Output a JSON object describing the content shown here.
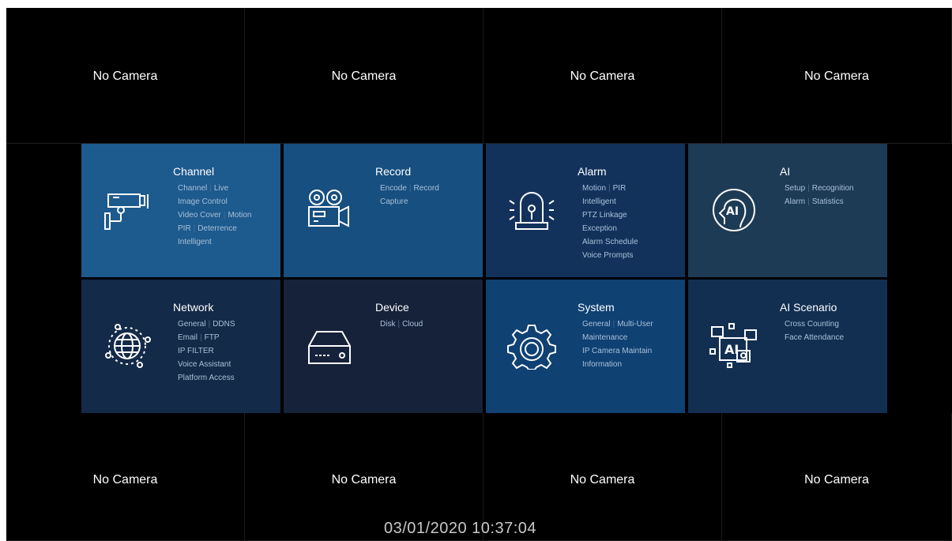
{
  "camera_label": "No Camera",
  "timestamp": "03/01/2020 10:37:04",
  "menu": {
    "channel": {
      "title": "Channel",
      "links": [
        "Channel",
        "Live",
        "Image Control",
        "Video Cover",
        "Motion",
        "PIR",
        "Deterrence",
        "Intelligent"
      ],
      "icon": "security-camera-icon",
      "color": "#1d5a8e"
    },
    "record": {
      "title": "Record",
      "links": [
        "Encode",
        "Record",
        "Capture"
      ],
      "icon": "film-camera-icon",
      "color": "#174f80"
    },
    "alarm": {
      "title": "Alarm",
      "links": [
        "Motion",
        "PIR",
        "Intelligent",
        "PTZ Linkage",
        "Exception",
        "Alarm Schedule",
        "Voice Prompts"
      ],
      "icon": "alarm-siren-icon",
      "color": "#12325c"
    },
    "ai": {
      "title": "AI",
      "links": [
        "Setup",
        "Recognition",
        "Alarm",
        "Statistics"
      ],
      "icon": "ai-head-icon",
      "color": "#1e3b55"
    },
    "network": {
      "title": "Network",
      "links": [
        "General",
        "DDNS",
        "Email",
        "FTP",
        "IP FILTER",
        "Voice Assistant",
        "Platform Access"
      ],
      "icon": "globe-network-icon",
      "color": "#132a48"
    },
    "device": {
      "title": "Device",
      "links": [
        "Disk",
        "Cloud"
      ],
      "icon": "hard-disk-icon",
      "color": "#16223a"
    },
    "system": {
      "title": "System",
      "links": [
        "General",
        "Multi-User",
        "Maintenance",
        "IP Camera Maintain",
        "Information"
      ],
      "icon": "gear-icon",
      "color": "#0f4173"
    },
    "ai_scenario": {
      "title": "AI Scenario",
      "links": [
        "Cross Counting",
        "Face Attendance"
      ],
      "icon": "ai-scenario-icon",
      "color": "#122f52"
    }
  }
}
